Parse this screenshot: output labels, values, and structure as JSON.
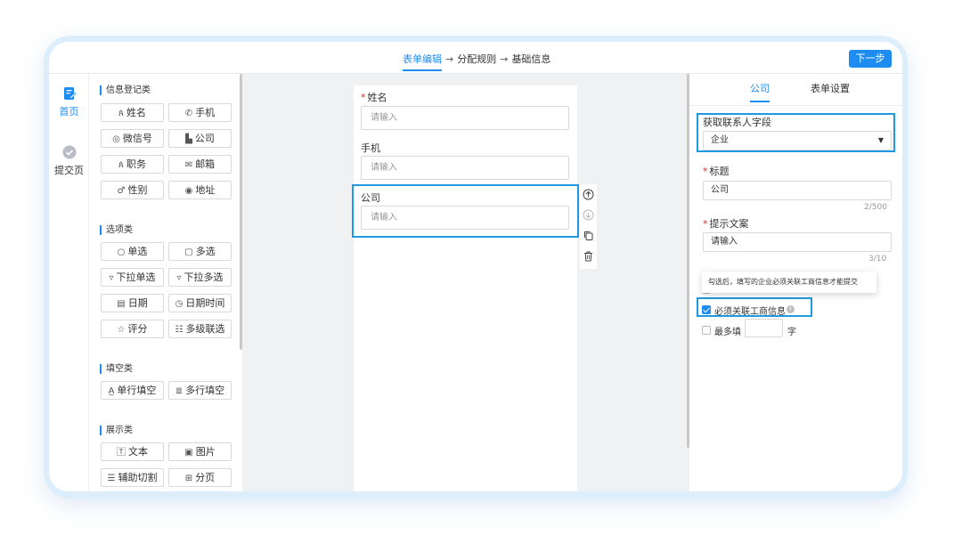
{
  "header": {
    "steps": [
      "表单编辑",
      "分配规则",
      "基础信息"
    ],
    "next_label": "下一步"
  },
  "nav": {
    "items": [
      {
        "label": "首页",
        "icon": "edit-form-icon",
        "active": true
      },
      {
        "label": "提交页",
        "icon": "check-circle-icon",
        "active": false
      }
    ]
  },
  "palette": {
    "categories": [
      {
        "title": "信息登记类"
      },
      {
        "title": "选项类"
      },
      {
        "title": "填空类"
      },
      {
        "title": "展示类"
      }
    ],
    "widgets": {
      "name": "姓名",
      "phone": "手机",
      "wechat": "微信号",
      "company": "公司",
      "position": "职务",
      "email": "邮箱",
      "gender": "性别",
      "address": "地址",
      "single": "单选",
      "multi": "多选",
      "dropdown_single": "下拉单选",
      "dropdown_multi": "下拉多选",
      "date": "日期",
      "datetime": "日期时间",
      "rating": "评分",
      "cascade": "多级联选",
      "single_line": "单行填空",
      "multi_line": "多行填空",
      "text": "文本",
      "image": "图片",
      "divider": "辅助切割",
      "paging": "分页"
    }
  },
  "form": {
    "fields": [
      {
        "label": "姓名",
        "required": true,
        "placeholder": "请输入"
      },
      {
        "label": "手机",
        "required": false,
        "placeholder": "请输入"
      },
      {
        "label": "公司",
        "required": false,
        "placeholder": "请输入"
      }
    ]
  },
  "props": {
    "tabs": [
      "公司",
      "表单设置"
    ],
    "contact_field_label": "获取联系人字段",
    "contact_field_value": "企业",
    "title_label": "标题",
    "title_value": "公司",
    "title_counter": "2/500",
    "hint_label": "提示文案",
    "hint_value": "请输入",
    "hint_counter": "3/10",
    "tooltip": "勾选后，填写的企业必须关联工商信息才能提交",
    "must_link_label": "必须关联工商信息",
    "max_label": "最多填",
    "max_unit": "字"
  },
  "colors": {
    "accent": "#1f8cf2",
    "highlight": "#1f9ae0",
    "frame": "#dcedfb"
  }
}
